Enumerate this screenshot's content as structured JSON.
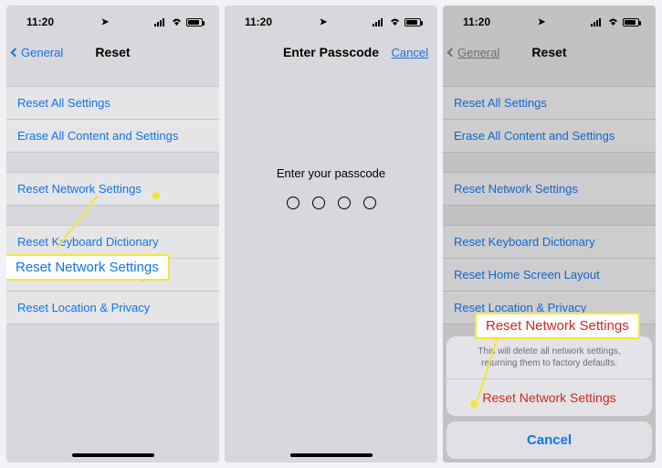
{
  "status": {
    "time": "11:20"
  },
  "screen1": {
    "back": "General",
    "title": "Reset",
    "items": [
      "Reset All Settings",
      "Erase All Content and Settings",
      "Reset Network Settings",
      "Reset Keyboard Dictionary",
      "Reset Home Screen Layout",
      "Reset Location & Privacy"
    ],
    "callout": "Reset Network Settings"
  },
  "screen2": {
    "title": "Enter Passcode",
    "cancel": "Cancel",
    "prompt": "Enter your passcode"
  },
  "screen3": {
    "back": "General",
    "title": "Reset",
    "items": [
      "Reset All Settings",
      "Erase All Content and Settings",
      "Reset Network Settings",
      "Reset Keyboard Dictionary",
      "Reset Home Screen Layout",
      "Reset Location & Privacy"
    ],
    "sheet": {
      "message": "This will delete all network settings, returning them to factory defaults.",
      "action": "Reset Network Settings",
      "cancel": "Cancel"
    },
    "callout": "Reset Network Settings"
  }
}
